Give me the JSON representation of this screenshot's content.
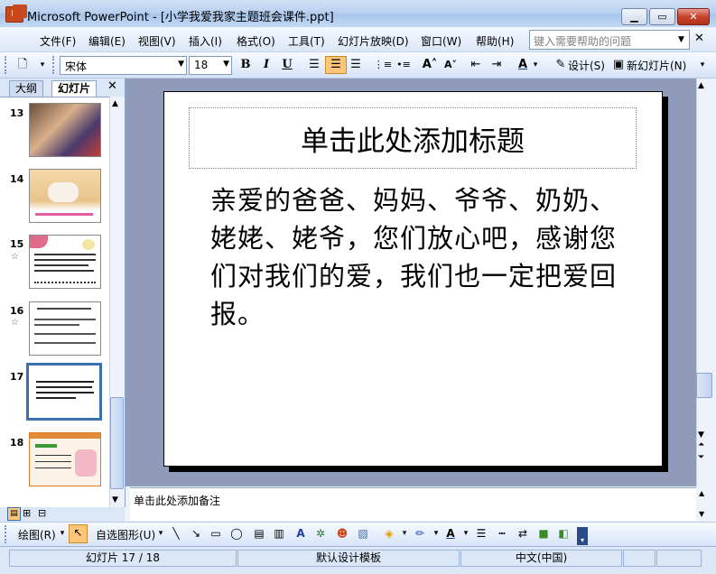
{
  "window": {
    "title": "Microsoft PowerPoint - [小学我爱我家主题班会课件.ppt]",
    "app_icon_letter": "P"
  },
  "menu": {
    "items": [
      "文件(F)",
      "编辑(E)",
      "视图(V)",
      "插入(I)",
      "格式(O)",
      "工具(T)",
      "幻灯片放映(D)",
      "窗口(W)",
      "帮助(H)"
    ],
    "help_placeholder": "键入需要帮助的问题"
  },
  "format_toolbar": {
    "font_name": "宋体",
    "font_size": "18",
    "design_label": "设计(S)",
    "new_slide_label": "新幻灯片(N)"
  },
  "left_pane": {
    "tabs": [
      "大纲",
      "幻灯片"
    ],
    "slides": [
      {
        "number": "13",
        "has_animation": false
      },
      {
        "number": "14",
        "has_animation": false
      },
      {
        "number": "15",
        "has_animation": true
      },
      {
        "number": "16",
        "has_animation": true
      },
      {
        "number": "17",
        "has_animation": false,
        "selected": true
      },
      {
        "number": "18",
        "has_animation": false
      }
    ]
  },
  "slide": {
    "title_placeholder": "单击此处添加标题",
    "body_text": "亲爱的爸爸、妈妈、爷爷、奶奶、姥姥、姥爷，您们放心吧，感谢您们对我们的爱，我们也一定把爱回报。"
  },
  "notes": {
    "placeholder": "单击此处添加备注"
  },
  "draw_toolbar": {
    "draw_label": "绘图(R)",
    "autoshapes_label": "自选图形(U)"
  },
  "statusbar": {
    "slide_position": "幻灯片 17 / 18",
    "design_template": "默认设计模板",
    "language": "中文(中国)"
  }
}
